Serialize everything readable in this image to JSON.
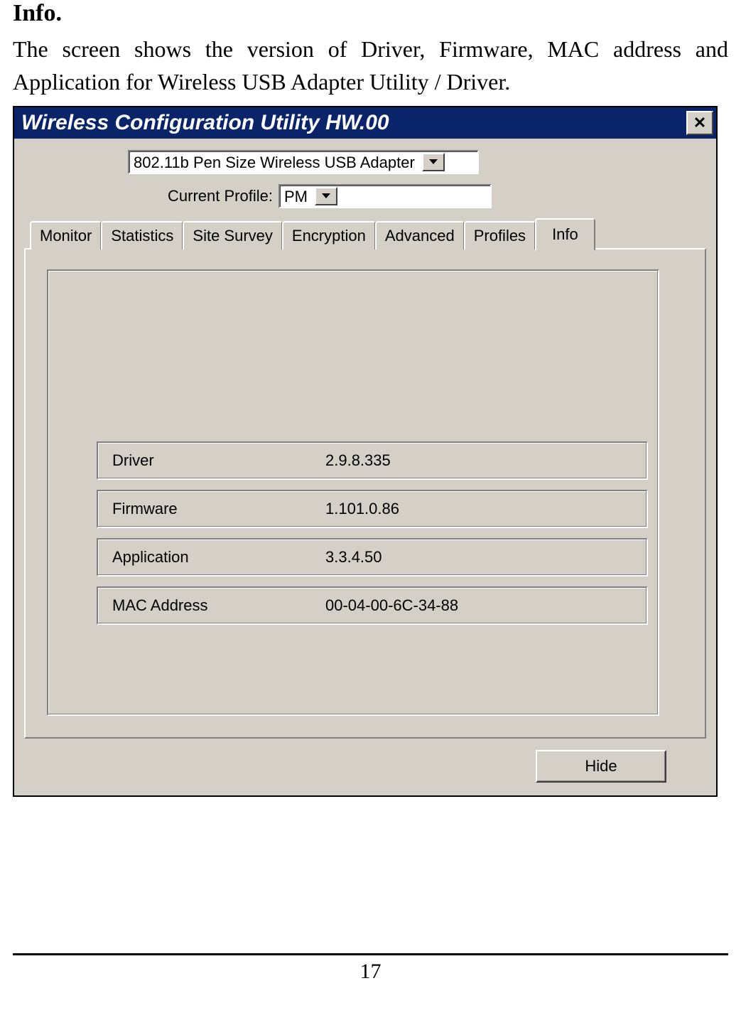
{
  "doc": {
    "heading": "Info.",
    "paragraph": "The screen shows the version of Driver, Firmware, MAC address and Application for Wireless USB Adapter Utility / Driver.",
    "page_number": "17"
  },
  "window": {
    "title": "Wireless Configuration Utility HW.00"
  },
  "adapter": {
    "value": "802.11b Pen Size Wireless USB Adapter"
  },
  "profile": {
    "label": "Current Profile:",
    "value": "PM"
  },
  "tabs": [
    "Monitor",
    "Statistics",
    "Site Survey",
    "Encryption",
    "Advanced",
    "Profiles",
    "Info"
  ],
  "active_tab_index": 6,
  "info_rows": [
    {
      "label": "Driver",
      "value": "2.9.8.335"
    },
    {
      "label": "Firmware",
      "value": "1.101.0.86"
    },
    {
      "label": "Application",
      "value": "3.3.4.50"
    },
    {
      "label": "MAC Address",
      "value": "00-04-00-6C-34-88"
    }
  ],
  "buttons": {
    "hide": "Hide"
  }
}
